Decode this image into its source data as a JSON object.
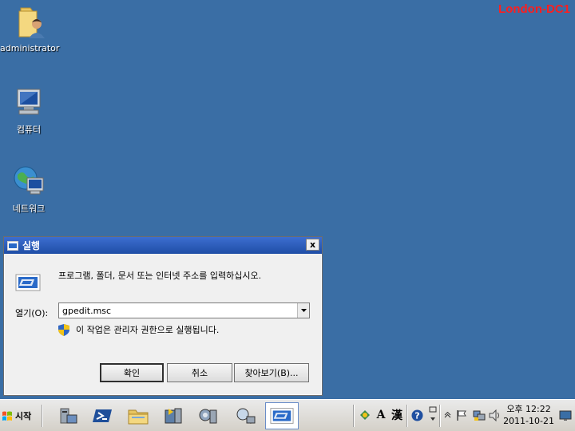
{
  "machine_name": "London-DC1",
  "desktop": {
    "icons": [
      {
        "label": "administrator",
        "icon": "user-folder-icon"
      },
      {
        "label": "컴퓨터",
        "icon": "computer-icon"
      },
      {
        "label": "네트워크",
        "icon": "network-icon"
      }
    ]
  },
  "dialog": {
    "title": "실행",
    "close_label": "x",
    "description": "프로그램, 폴더, 문서 또는 인터넷 주소를 입력하십시오.",
    "open_label": "열기(O):",
    "open_value": "gpedit.msc",
    "admin_note": "이 작업은 관리자 권한으로 실행됩니다.",
    "ok_label": "확인",
    "cancel_label": "취소",
    "browse_label": "찾아보기(B)..."
  },
  "taskbar": {
    "start_label": "시작",
    "ime_mode": "A",
    "ime_hanja": "漢",
    "clock_period": "오후 12:22",
    "clock_date": "2011-10-21"
  }
}
